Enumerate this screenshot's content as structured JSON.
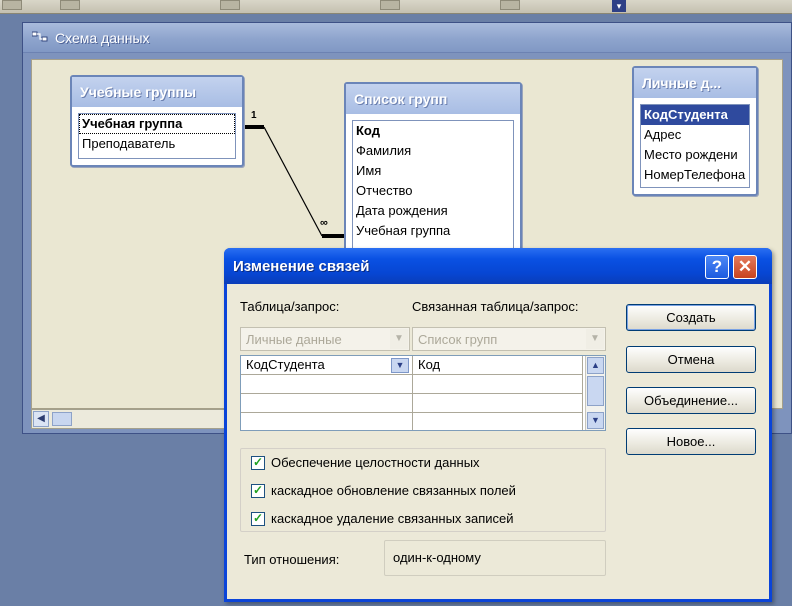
{
  "mdi": {
    "title": "Схема данных"
  },
  "tables": [
    {
      "title": "Учебные группы",
      "fields": [
        "Учебная группа",
        "Преподаватель"
      ]
    },
    {
      "title": "Список групп",
      "fields": [
        "Код",
        "Фамилия",
        "Имя",
        "Отчество",
        "Дата рождения",
        "Учебная группа"
      ]
    },
    {
      "title": "Личные д...",
      "fields": [
        "КодСтудента",
        "Адрес",
        "Место рождени",
        "НомерТелефона"
      ]
    }
  ],
  "relationship": {
    "one_marker": "1",
    "many_marker": "∞"
  },
  "dialog": {
    "title": "Изменение связей",
    "table_label": "Таблица/запрос:",
    "related_label": "Связанная таблица/запрос:",
    "table_value": "Личные данные",
    "related_value": "Список групп",
    "grid_rows": [
      {
        "left": "КодСтудента",
        "right": "Код"
      }
    ],
    "checkboxes": [
      {
        "label": "Обеспечение целостности данных",
        "checked": true
      },
      {
        "label": "каскадное обновление связанных полей",
        "checked": true
      },
      {
        "label": "каскадное удаление связанных записей",
        "checked": true
      }
    ],
    "relation_type_label": "Тип отношения:",
    "relation_type_value": "один-к-одному",
    "buttons": {
      "create": "Создать",
      "cancel": "Отмена",
      "join": "Объединение...",
      "new": "Новое..."
    },
    "help_glyph": "?",
    "close_glyph": "✕"
  },
  "colors": {
    "titlebar": "#0a51e3",
    "selection": "#2f4a9e",
    "canvas": "#eae7d2",
    "dialog_face": "#ece9d8"
  }
}
